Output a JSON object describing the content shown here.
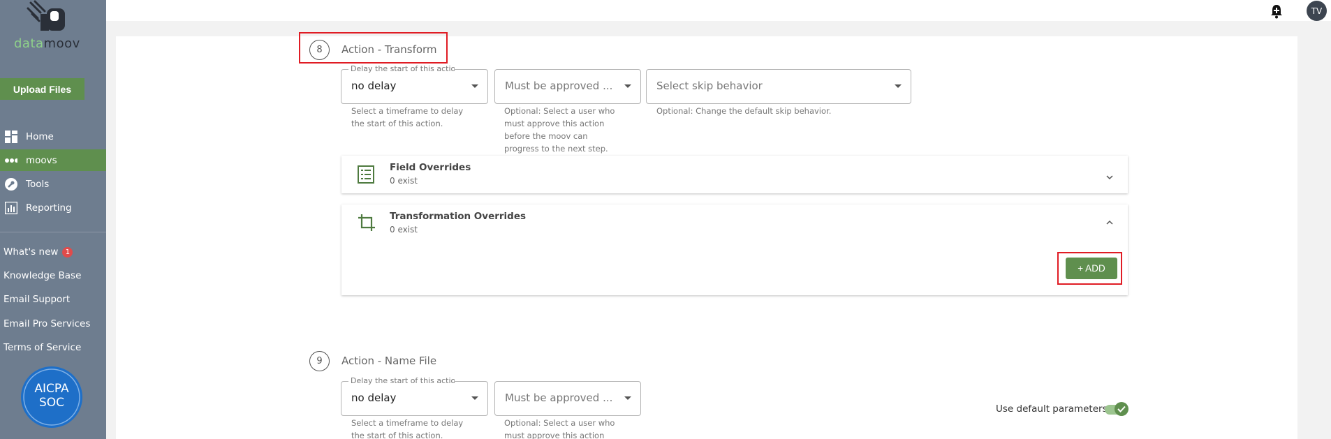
{
  "sidebar": {
    "logo_text_green": "data",
    "logo_text_dark": "moov",
    "upload_label": "Upload Files",
    "nav": [
      {
        "label": "Home",
        "icon": "home-grid-icon"
      },
      {
        "label": "moovs",
        "icon": "moovs-dots-icon"
      },
      {
        "label": "Tools",
        "icon": "wrench-icon"
      },
      {
        "label": "Reporting",
        "icon": "chart-icon"
      }
    ],
    "whats_new": "What's new",
    "whats_new_count": "1",
    "knowledge_base": "Knowledge Base",
    "email_support": "Email Support",
    "email_pro": "Email Pro Services",
    "terms": "Terms of Service",
    "soc_line1": "AICPA",
    "soc_line2": "SOC"
  },
  "header": {
    "avatar_initials": "TV",
    "bell_icon": "bell-plus-icon"
  },
  "step8": {
    "number": "8",
    "title": "Action - Transform",
    "delay": {
      "legend": "Delay the start of this action",
      "value": "no delay",
      "help": [
        "Select a timeframe to delay",
        "the start of this action."
      ]
    },
    "approve": {
      "placeholder": "Must be approved ...",
      "help": [
        "Optional: Select a user who",
        "must approve this action",
        "before the moov can",
        "progress to the next step."
      ]
    },
    "skip": {
      "placeholder": "Select skip behavior",
      "help": "Optional: Change the default skip behavior."
    },
    "field_overrides": {
      "title": "Field Overrides",
      "count": "0 exist"
    },
    "transformation_overrides": {
      "title": "Transformation Overrides",
      "count": "0 exist"
    },
    "add_label": "+ ADD"
  },
  "step9": {
    "number": "9",
    "title": "Action - Name File",
    "delay": {
      "legend": "Delay the start of this action",
      "value": "no delay",
      "help": [
        "Select a timeframe to delay",
        "the start of this action."
      ]
    },
    "approve": {
      "placeholder": "Must be approved ...",
      "help": [
        "Optional: Select a user who",
        "must approve this action"
      ]
    },
    "toggle_label": "Use default parameters",
    "toggle_on": true
  },
  "colors": {
    "sidebar": "#6e7d8f",
    "accent_green": "#5f8f4e",
    "highlight_red": "#e01c24",
    "badge_red": "#e14b4b"
  }
}
